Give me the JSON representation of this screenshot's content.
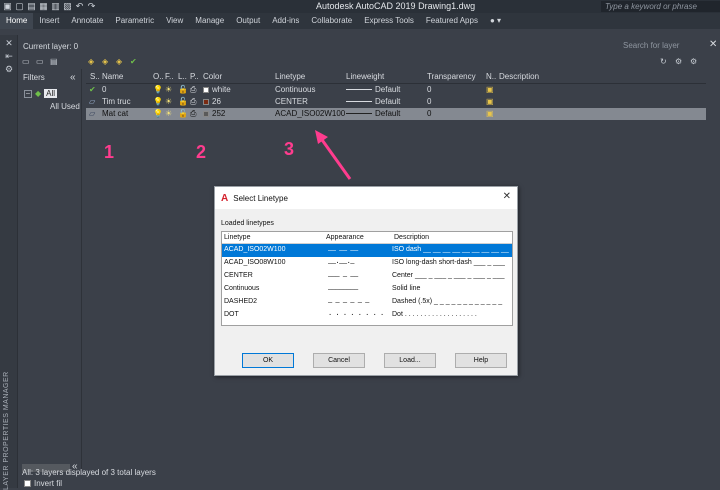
{
  "app": {
    "title": "Autodesk AutoCAD 2019    Drawing1.dwg",
    "search_placeholder": "Type a keyword or phrase"
  },
  "ribbon_tabs": [
    "Home",
    "Insert",
    "Annotate",
    "Parametric",
    "View",
    "Manage",
    "Output",
    "Add-ins",
    "Collaborate",
    "Express Tools",
    "Featured Apps"
  ],
  "palette": {
    "current_layer": "Current layer: 0",
    "search_placeholder": "Search for layer",
    "vertical_label": "LAYER PROPERTIES MANAGER",
    "filters_header": "Filters",
    "tree_all": "All",
    "tree_used": "All Used Layers",
    "invert_filter": "Invert fil",
    "status": "All: 3 layers displayed of 3 total layers"
  },
  "grid": {
    "headers": [
      "S..",
      "Name",
      "O..",
      "F..",
      "L..",
      "P..",
      "Color",
      "Linetype",
      "Lineweight",
      "Transparency",
      "N..",
      "Description"
    ],
    "rows": [
      {
        "name": "0",
        "color_name": "white",
        "color_hex": "#ffffff",
        "linetype": "Continuous",
        "lineweight": "Default",
        "transparency": "0",
        "selected": false
      },
      {
        "name": "Tim truc",
        "color_name": "26",
        "color_hex": "#7a2a12",
        "linetype": "CENTER",
        "lineweight": "Default",
        "transparency": "0",
        "selected": false
      },
      {
        "name": "Mat cat",
        "color_name": "252",
        "color_hex": "#5a5a5a",
        "linetype": "ACAD_ISO02W100",
        "lineweight": "Default",
        "transparency": "0",
        "selected": true
      }
    ]
  },
  "annotations": [
    "1",
    "2",
    "3"
  ],
  "dialog": {
    "title": "Select Linetype",
    "section_label": "Loaded linetypes",
    "columns": [
      "Linetype",
      "Appearance",
      "Description"
    ],
    "rows": [
      {
        "linetype": "ACAD_ISO02W100",
        "appearance": "—— —— ——",
        "description": "ISO dash __ __ __ __ __ __ __ __ __",
        "selected": true
      },
      {
        "linetype": "ACAD_ISO08W100",
        "appearance": "——·——·—",
        "description": "ISO long-dash short-dash ___ _ ___",
        "selected": false
      },
      {
        "linetype": "CENTER",
        "appearance": "——— — ——",
        "description": "Center ___ _ ___ _ ___ _ ___ _ ___",
        "selected": false
      },
      {
        "linetype": "Continuous",
        "appearance": "————————",
        "description": "Solid line",
        "selected": false
      },
      {
        "linetype": "DASHED2",
        "appearance": "– – – – – –",
        "description": "Dashed (.5x) _ _ _ _ _ _ _ _ _ _ _ _",
        "selected": false
      },
      {
        "linetype": "DOT",
        "appearance": "· · · · · · · ·",
        "description": "Dot . . . . . . . . . . . . . . . . . . .",
        "selected": false
      }
    ],
    "buttons": {
      "ok": "OK",
      "cancel": "Cancel",
      "load": "Load...",
      "help": "Help"
    }
  },
  "colors": {
    "accent": "#0078d7",
    "annotation": "#ff3c8e",
    "bg": "#3b4049"
  }
}
